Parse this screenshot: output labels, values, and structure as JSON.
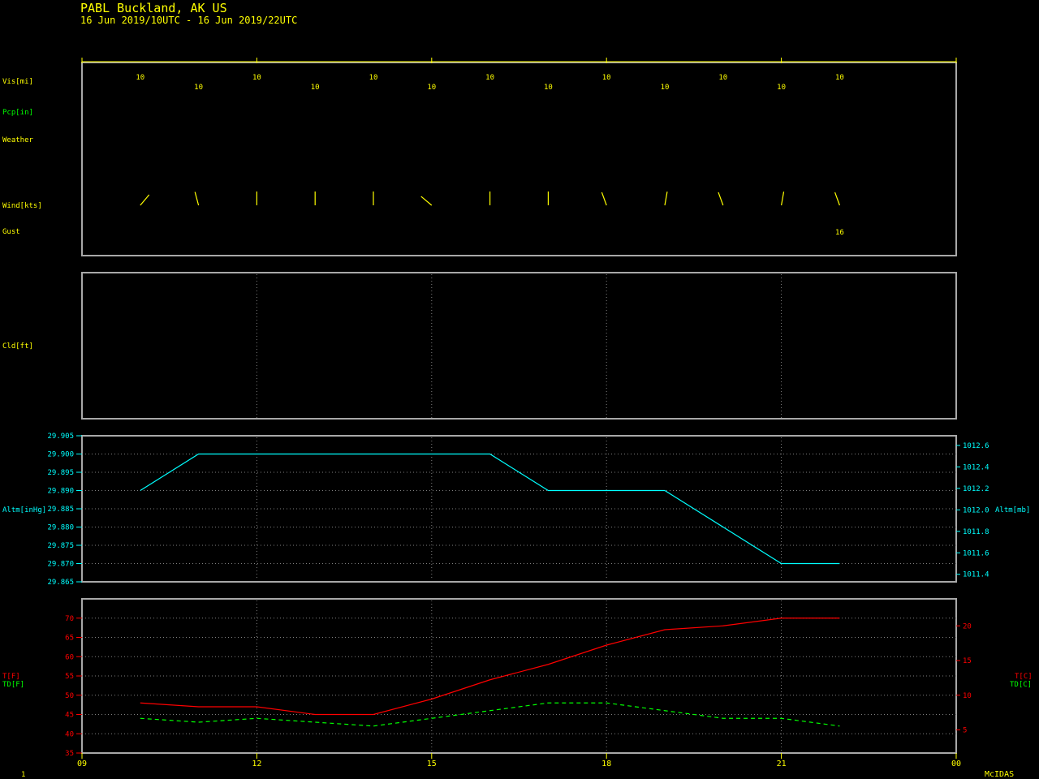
{
  "header": {
    "station": "PABL  Buckland, AK US",
    "period": "16 Jun 2019/10UTC - 16 Jun 2019/22UTC"
  },
  "labels": {
    "vis": "Vis[mi]",
    "pcp": "Pcp[in]",
    "weather": "Weather",
    "wind": "Wind[kts]",
    "gust": "Gust",
    "cld": "Cld[ft]",
    "altm_left": "Altm[inHg]",
    "altm_right": "Altm[mb]",
    "t_left": "T[F]",
    "td_left": "TD[F]",
    "t_right": "T[C]",
    "td_right": "TD[C]"
  },
  "footer": {
    "page": "1",
    "brand": "McIDAS"
  },
  "colors": {
    "yellow": "#ffff00",
    "green": "#00ff00",
    "cyan": "#00ffff",
    "red": "#ff0000",
    "frame": "#a8a8a8",
    "grid": "#808080"
  },
  "chart_data": [
    {
      "type": "table",
      "panel": "surface-obs",
      "hours": [
        10,
        11,
        12,
        13,
        14,
        15,
        16,
        17,
        18,
        19,
        20,
        21,
        22
      ],
      "visibility": [
        "10",
        "10",
        "10",
        "10",
        "10",
        "10",
        "10",
        "10",
        "10",
        "10",
        "10",
        "10",
        "10"
      ],
      "wind_dir": [
        40,
        345,
        360,
        360,
        360,
        310,
        360,
        360,
        340,
        10,
        340,
        10,
        340
      ],
      "gust": [
        null,
        null,
        null,
        null,
        null,
        null,
        null,
        null,
        null,
        null,
        null,
        null,
        "16"
      ]
    },
    {
      "type": "line",
      "panel": "altimeter",
      "x": [
        10,
        11,
        12,
        13,
        14,
        15,
        16,
        17,
        18,
        19,
        20,
        21,
        22
      ],
      "series": [
        {
          "values": [
            29.89,
            29.9,
            29.9,
            29.9,
            29.9,
            29.9,
            29.9,
            29.89,
            29.89,
            29.89,
            29.88,
            29.87,
            29.87
          ],
          "color": "#00ffff"
        }
      ],
      "ylim": [
        29.865,
        29.905
      ],
      "yticks": [
        "29.905",
        "29.900",
        "29.895",
        "29.890",
        "29.885",
        "29.880",
        "29.875",
        "29.870",
        "29.865"
      ],
      "ylim_mb": [
        1011.33,
        1012.69
      ],
      "yticks_mb": [
        "1012.6",
        "1012.4",
        "1012.2",
        "1012.0",
        "1011.8",
        "1011.6",
        "1011.4"
      ]
    },
    {
      "type": "line",
      "panel": "temperature",
      "x": [
        10,
        11,
        12,
        13,
        14,
        15,
        16,
        17,
        18,
        19,
        20,
        21,
        22
      ],
      "series": [
        {
          "values": [
            48,
            47,
            47,
            45,
            45,
            49,
            54,
            58,
            63,
            67,
            68,
            70,
            70
          ],
          "color": "#ff0000",
          "dash": false
        },
        {
          "values": [
            44,
            43,
            44,
            43,
            42,
            44,
            46,
            48,
            48,
            46,
            44,
            44,
            42
          ],
          "color": "#00ff00",
          "dash": true
        }
      ],
      "ylim": [
        35,
        75
      ],
      "yticks": [
        "35",
        "40",
        "45",
        "50",
        "55",
        "60",
        "65",
        "70"
      ],
      "yticks_c": [
        "5",
        "10",
        "15",
        "20"
      ]
    }
  ],
  "x_axis": {
    "ticks": [
      "09",
      "12",
      "15",
      "18",
      "21",
      "00"
    ],
    "range": [
      9,
      24
    ]
  }
}
